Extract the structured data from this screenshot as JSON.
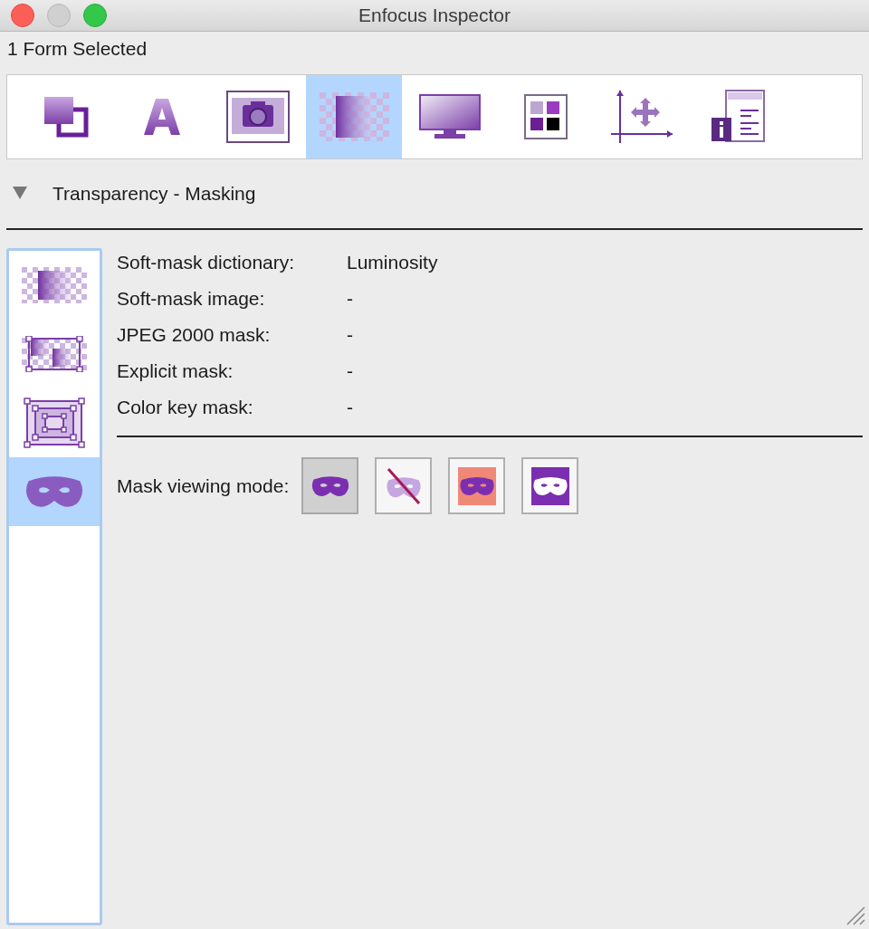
{
  "window": {
    "title": "Enfocus Inspector"
  },
  "selection_label": "1 Form Selected",
  "toolbar": [
    {
      "kind": "objects",
      "selected": false
    },
    {
      "kind": "text",
      "selected": false
    },
    {
      "kind": "image",
      "selected": false
    },
    {
      "kind": "transparency",
      "selected": true
    },
    {
      "kind": "display",
      "selected": false
    },
    {
      "kind": "color",
      "selected": false
    },
    {
      "kind": "position",
      "selected": false
    },
    {
      "kind": "info",
      "selected": false
    }
  ],
  "section": {
    "title": "Transparency - Masking",
    "expanded": true
  },
  "side_list": [
    {
      "kind": "soft-mask",
      "selected": false
    },
    {
      "kind": "mask-image",
      "selected": false
    },
    {
      "kind": "frame",
      "selected": false
    },
    {
      "kind": "mask",
      "selected": true
    }
  ],
  "properties": [
    {
      "label": "Soft-mask dictionary:",
      "value": "Luminosity"
    },
    {
      "label": "Soft-mask image:",
      "value": "-"
    },
    {
      "label": "JPEG 2000 mask:",
      "value": "-"
    },
    {
      "label": "Explicit mask:",
      "value": "-"
    },
    {
      "label": "Color key mask:",
      "value": "-"
    }
  ],
  "mask_mode": {
    "label": "Mask viewing mode:",
    "modes": [
      {
        "kind": "normal",
        "selected": true
      },
      {
        "kind": "hidden",
        "selected": false
      },
      {
        "kind": "highlight",
        "selected": false
      },
      {
        "kind": "inverted",
        "selected": false
      }
    ]
  }
}
